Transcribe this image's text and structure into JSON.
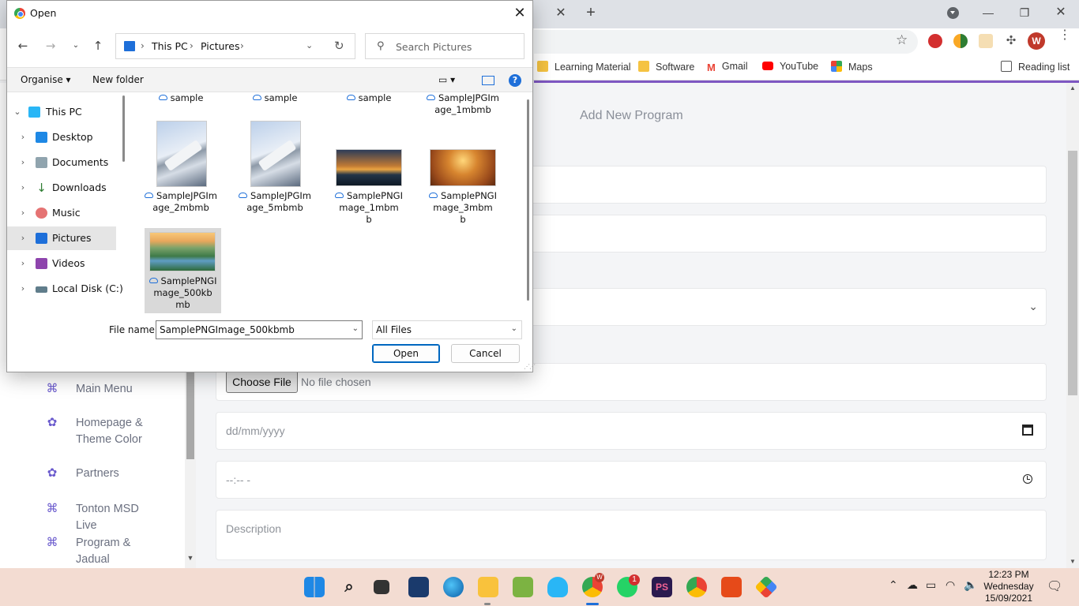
{
  "dialog": {
    "title": "Open",
    "breadcrumb": [
      "This PC",
      "Pictures"
    ],
    "search_placeholder": "Search Pictures",
    "organise_label": "Organise",
    "new_folder_label": "New folder",
    "help_label": "?",
    "tree": [
      {
        "label": "This PC",
        "icon": "computer-icon",
        "expanded": true,
        "selected": false
      },
      {
        "label": "Desktop",
        "icon": "desktop-icon",
        "selected": false
      },
      {
        "label": "Documents",
        "icon": "documents-icon",
        "selected": false
      },
      {
        "label": "Downloads",
        "icon": "downloads-icon",
        "selected": false
      },
      {
        "label": "Music",
        "icon": "music-icon",
        "selected": false
      },
      {
        "label": "Pictures",
        "icon": "pictures-icon",
        "selected": true
      },
      {
        "label": "Videos",
        "icon": "videos-icon",
        "selected": false
      },
      {
        "label": "Local Disk (C:)",
        "icon": "disk-icon",
        "selected": false
      }
    ],
    "files": [
      {
        "name": "sample",
        "thumb": "none",
        "selected": false
      },
      {
        "name": "sample",
        "thumb": "none",
        "selected": false
      },
      {
        "name": "sample",
        "thumb": "none",
        "selected": false
      },
      {
        "name": "SampleJPGIm\nage_1mbmb",
        "thumb": "none",
        "selected": false
      },
      {
        "name": "SampleJPGIm\nage_2mbmb",
        "thumb": "wing",
        "selected": false
      },
      {
        "name": "SampleJPGIm\nage_5mbmb",
        "thumb": "wing",
        "selected": false
      },
      {
        "name": "SamplePNGI\nmage_1mbm\nb",
        "thumb": "sunset",
        "selected": false
      },
      {
        "name": "SamplePNGI\nmage_3mbm\nb",
        "thumb": "field",
        "selected": false
      },
      {
        "name": "SamplePNGI\nmage_500kb\nmb",
        "thumb": "valley",
        "selected": true
      }
    ],
    "file_name_label": "File name:",
    "file_name_value": "SamplePNGImage_500kbmb",
    "file_type": "All Files",
    "open_label": "Open",
    "cancel_label": "Cancel"
  },
  "browser": {
    "bookmarks": [
      {
        "label": "Learning Material",
        "icon": "folder-icon",
        "color": "#f5c342"
      },
      {
        "label": "Software",
        "icon": "folder-icon",
        "color": "#f5c342"
      },
      {
        "label": "Gmail",
        "icon": "gmail-icon",
        "color": "#ea4335"
      },
      {
        "label": "YouTube",
        "icon": "youtube-icon",
        "color": "#ff0000"
      },
      {
        "label": "Maps",
        "icon": "maps-icon",
        "color": "#34a853"
      }
    ],
    "reading_list_label": "Reading list",
    "profile_initial": "W"
  },
  "page": {
    "header_title": "Add New Program",
    "sidebar": [
      {
        "label": "Main Menu",
        "icon": "menu-icon"
      },
      {
        "label": "Homepage & Theme Color",
        "icon": "palette-icon"
      },
      {
        "label": "Partners",
        "icon": "palette-icon"
      },
      {
        "label": "Tonton MSD Live",
        "icon": "menu-icon"
      },
      {
        "label": "Program & Jadual",
        "icon": "menu-icon"
      }
    ],
    "choose_file_label": "Choose File",
    "no_file_label": "No file chosen",
    "date_placeholder": "dd/mm/yyyy",
    "time_placeholder": "--:-- -",
    "description_placeholder": "Description"
  },
  "taskbar": {
    "time": "12:23 PM",
    "day": "Wednesday",
    "date": "15/09/2021",
    "whatsapp_badge": "1",
    "chrome_badge": "W"
  }
}
